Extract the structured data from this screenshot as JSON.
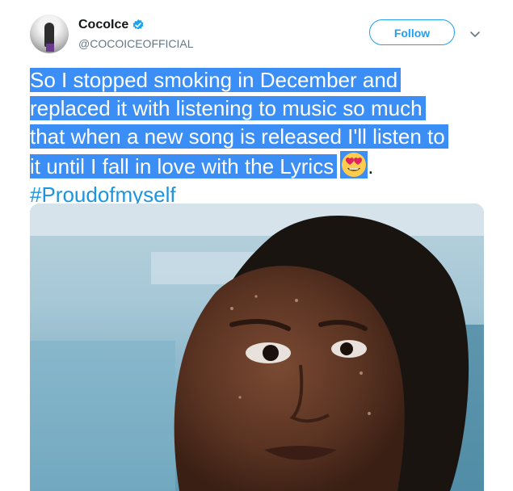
{
  "tweet": {
    "author": {
      "display_name": "CocoIce",
      "handle": "@COCOICEOFFICIAL",
      "verified": true
    },
    "follow_label": "Follow",
    "text_lines": [
      "So I stopped smoking in December and",
      "replaced it with listening to music so much",
      "that when a new song is released I'll listen to",
      "it until I fall in love with the Lyrics"
    ],
    "trailing_period": ".",
    "emoji": "smiling-face-with-heart-eyes",
    "hashtag": "#Proudofmyself"
  },
  "colors": {
    "accent": "#1da1f2",
    "hashtag": "#1b95e0",
    "selection": "#3a8ef5",
    "secondary_text": "#657786"
  }
}
